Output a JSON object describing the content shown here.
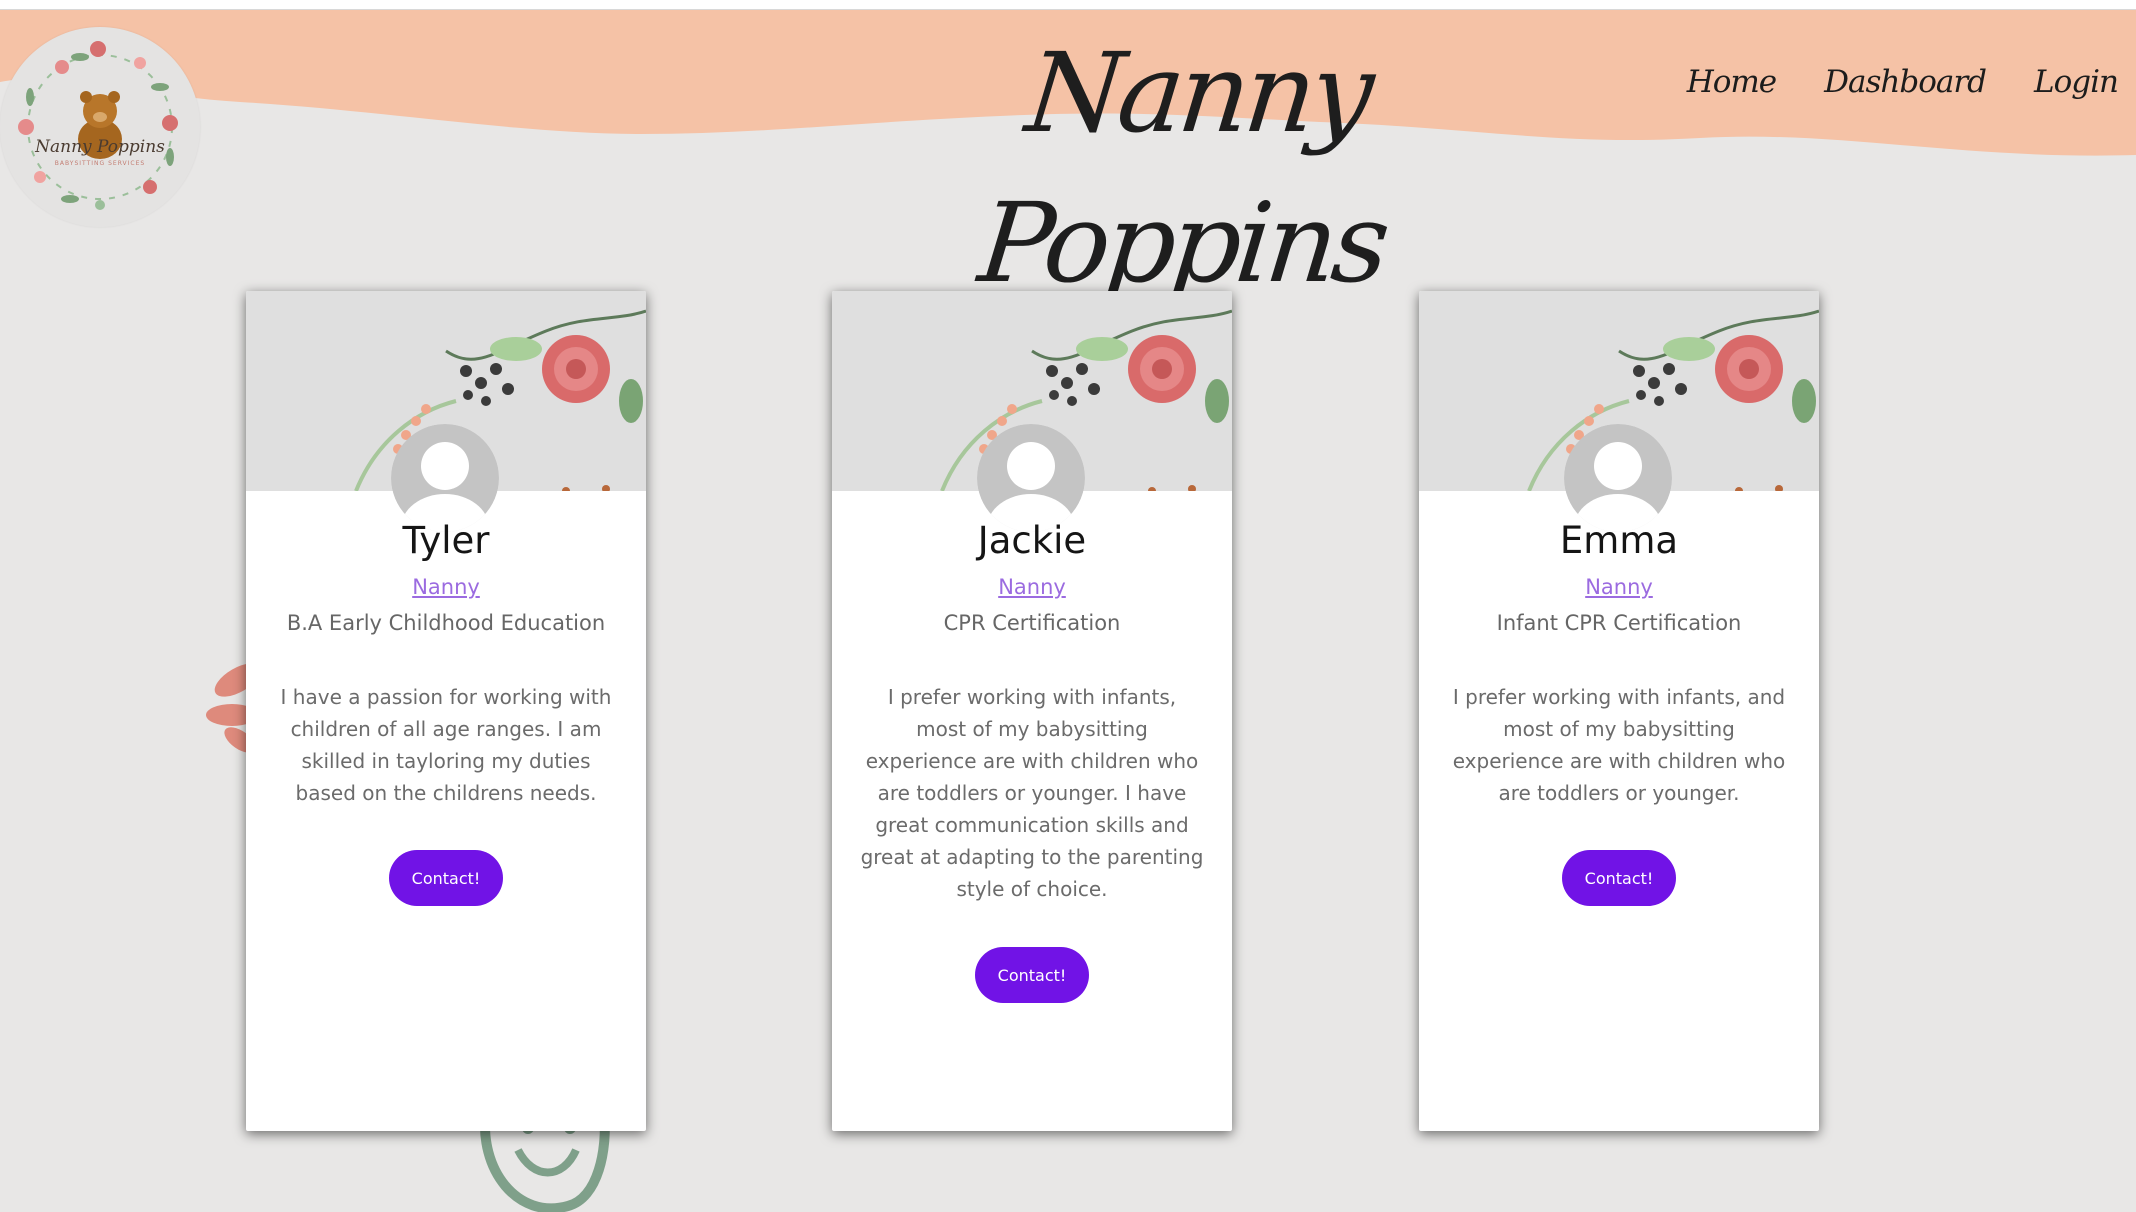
{
  "header": {
    "site_title": "Nanny Poppins",
    "logo_text": "Nanny Poppins",
    "logo_subtext": "BABYSITTING SERVICES",
    "nav": [
      "Home",
      "Dashboard",
      "Login"
    ]
  },
  "colors": {
    "background": "#e8e7e6",
    "header_band": "#f5c2a6",
    "accent_button": "#7113e6",
    "role_link": "#9b6be0"
  },
  "cards": [
    {
      "name": "Tyler",
      "role": "Nanny",
      "certification": "B.A Early Childhood Education",
      "bio": "I have a passion for working with children of all age ranges. I am skilled in tayloring my duties based on the childrens needs.",
      "button": "Contact!"
    },
    {
      "name": "Jackie",
      "role": "Nanny",
      "certification": "CPR Certification",
      "bio": "I prefer working with infants, most of my babysitting experience are with children who are toddlers or younger. I have great communication skills and great at adapting to the parenting style of choice.",
      "button": "Contact!"
    },
    {
      "name": "Emma",
      "role": "Nanny",
      "certification": "Infant CPR Certification",
      "bio": "I prefer working with infants, and most of my babysitting experience are with children who are toddlers or younger.",
      "button": "Contact!"
    }
  ]
}
